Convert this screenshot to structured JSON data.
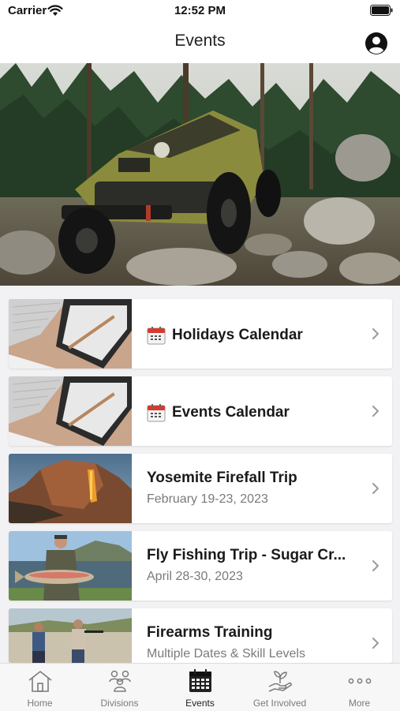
{
  "status_bar": {
    "carrier": "Carrier",
    "time": "12:52 PM"
  },
  "nav": {
    "title": "Events",
    "profile_icon": "person-circle-icon"
  },
  "hero": {
    "image": "jeep-on-rocky-trail"
  },
  "events": [
    {
      "title": "Holidays Calendar",
      "subtitle": "",
      "icon": "calendar-icon",
      "thumb": "tablet-keyboard-desk"
    },
    {
      "title": "Events Calendar",
      "subtitle": "",
      "icon": "calendar-icon",
      "thumb": "tablet-keyboard-desk"
    },
    {
      "title": "Yosemite Firefall Trip",
      "subtitle": "February 19-23, 2023",
      "thumb": "el-capitan-firefall"
    },
    {
      "title": "Fly Fishing Trip - Sugar Cr...",
      "subtitle": "April 28-30, 2023",
      "thumb": "angler-with-trout"
    },
    {
      "title": "Firearms Training",
      "subtitle": "Multiple Dates & Skill Levels",
      "thumb": "shooting-range"
    }
  ],
  "tabs": [
    {
      "label": "Home",
      "icon": "house-icon"
    },
    {
      "label": "Divisions",
      "icon": "people-icon"
    },
    {
      "label": "Events",
      "icon": "calendar-grid-icon",
      "active": true
    },
    {
      "label": "Get Involved",
      "icon": "hand-plant-icon"
    },
    {
      "label": "More",
      "icon": "more-dots-icon"
    }
  ],
  "colors": {
    "background": "#f2f2f4",
    "card": "#ffffff",
    "subtitle": "#7a7a7a",
    "tab_inactive": "#7b7b7b"
  }
}
